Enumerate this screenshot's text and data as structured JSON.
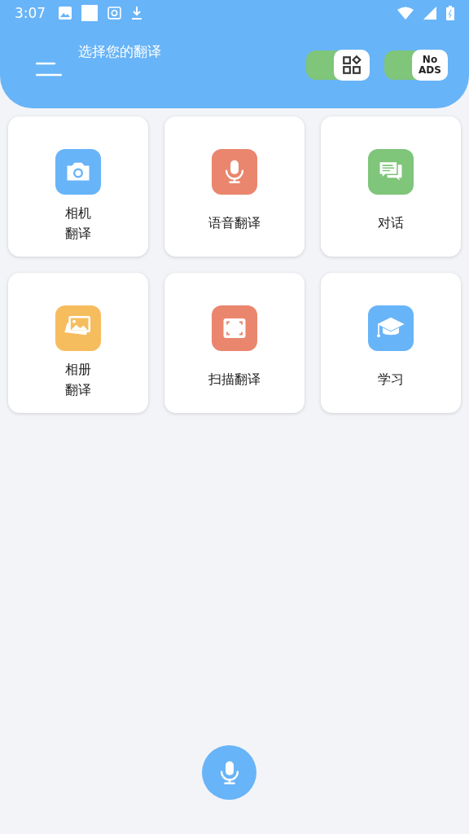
{
  "status_bar": {
    "time": "3:07"
  },
  "header": {
    "title": "选择您的翻译",
    "toggles": [
      {
        "kind": "apps",
        "on": true
      },
      {
        "kind": "noads",
        "on": true,
        "label": "No\nADS"
      }
    ]
  },
  "tiles": [
    {
      "kind": "camera",
      "label": "相机翻译",
      "wrap": true,
      "color": "#68b4f8"
    },
    {
      "kind": "mic",
      "label": "语音翻译",
      "color": "#ea866e"
    },
    {
      "kind": "chat",
      "label": "对话",
      "color": "#7fc57a"
    },
    {
      "kind": "gallery",
      "label": "相册翻译",
      "wrap": true,
      "color": "#f6bd5e"
    },
    {
      "kind": "scan",
      "label": "扫描翻译",
      "color": "#ea866e"
    },
    {
      "kind": "study",
      "label": "学习",
      "color": "#68b4f8"
    }
  ]
}
